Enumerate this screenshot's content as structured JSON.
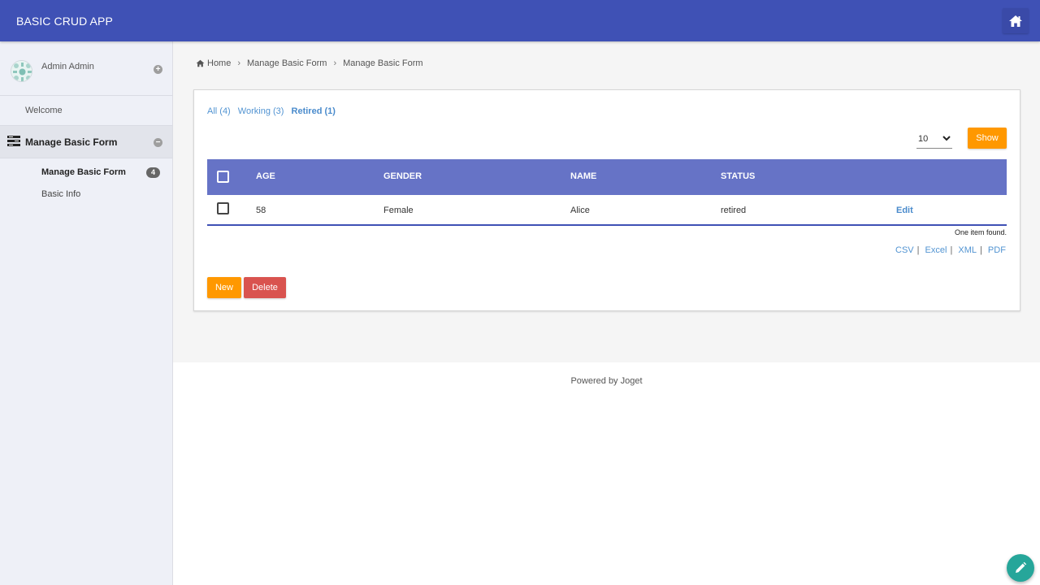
{
  "app": {
    "title": "BASIC CRUD APP",
    "home_icon": "home-icon",
    "brand_color": "#3f51b5"
  },
  "sidebar": {
    "user_name": "Admin Admin",
    "welcome": "Welcome",
    "category": {
      "label": "Manage Basic Form",
      "icon": "menu-list-icon"
    },
    "items": [
      {
        "label": "Manage Basic Form",
        "badge": "4",
        "active": true
      },
      {
        "label": "Basic Info",
        "active": false
      }
    ]
  },
  "breadcrumb": {
    "home": "Home",
    "items": [
      "Manage Basic Form",
      "Manage Basic Form"
    ]
  },
  "list": {
    "filters": [
      {
        "label": "All (4)",
        "active": false
      },
      {
        "label": "Working (3)",
        "active": false
      },
      {
        "label": "Retired (1)",
        "active": true
      }
    ],
    "page_size": "10",
    "show_label": "Show",
    "columns": [
      "AGE",
      "GENDER",
      "NAME",
      "STATUS"
    ],
    "rows": [
      {
        "age": "58",
        "gender": "Female",
        "name": "Alice",
        "status": "retired",
        "action": "Edit"
      }
    ],
    "found_text": "One item found.",
    "exports": [
      "CSV",
      "Excel",
      "XML",
      "PDF"
    ],
    "new_label": "New",
    "delete_label": "Delete",
    "accent_color": "#ff9800",
    "danger_color": "#d9534f"
  },
  "footer": {
    "text": "Powered by Joget"
  },
  "fab": {
    "icon": "pencil-icon"
  }
}
